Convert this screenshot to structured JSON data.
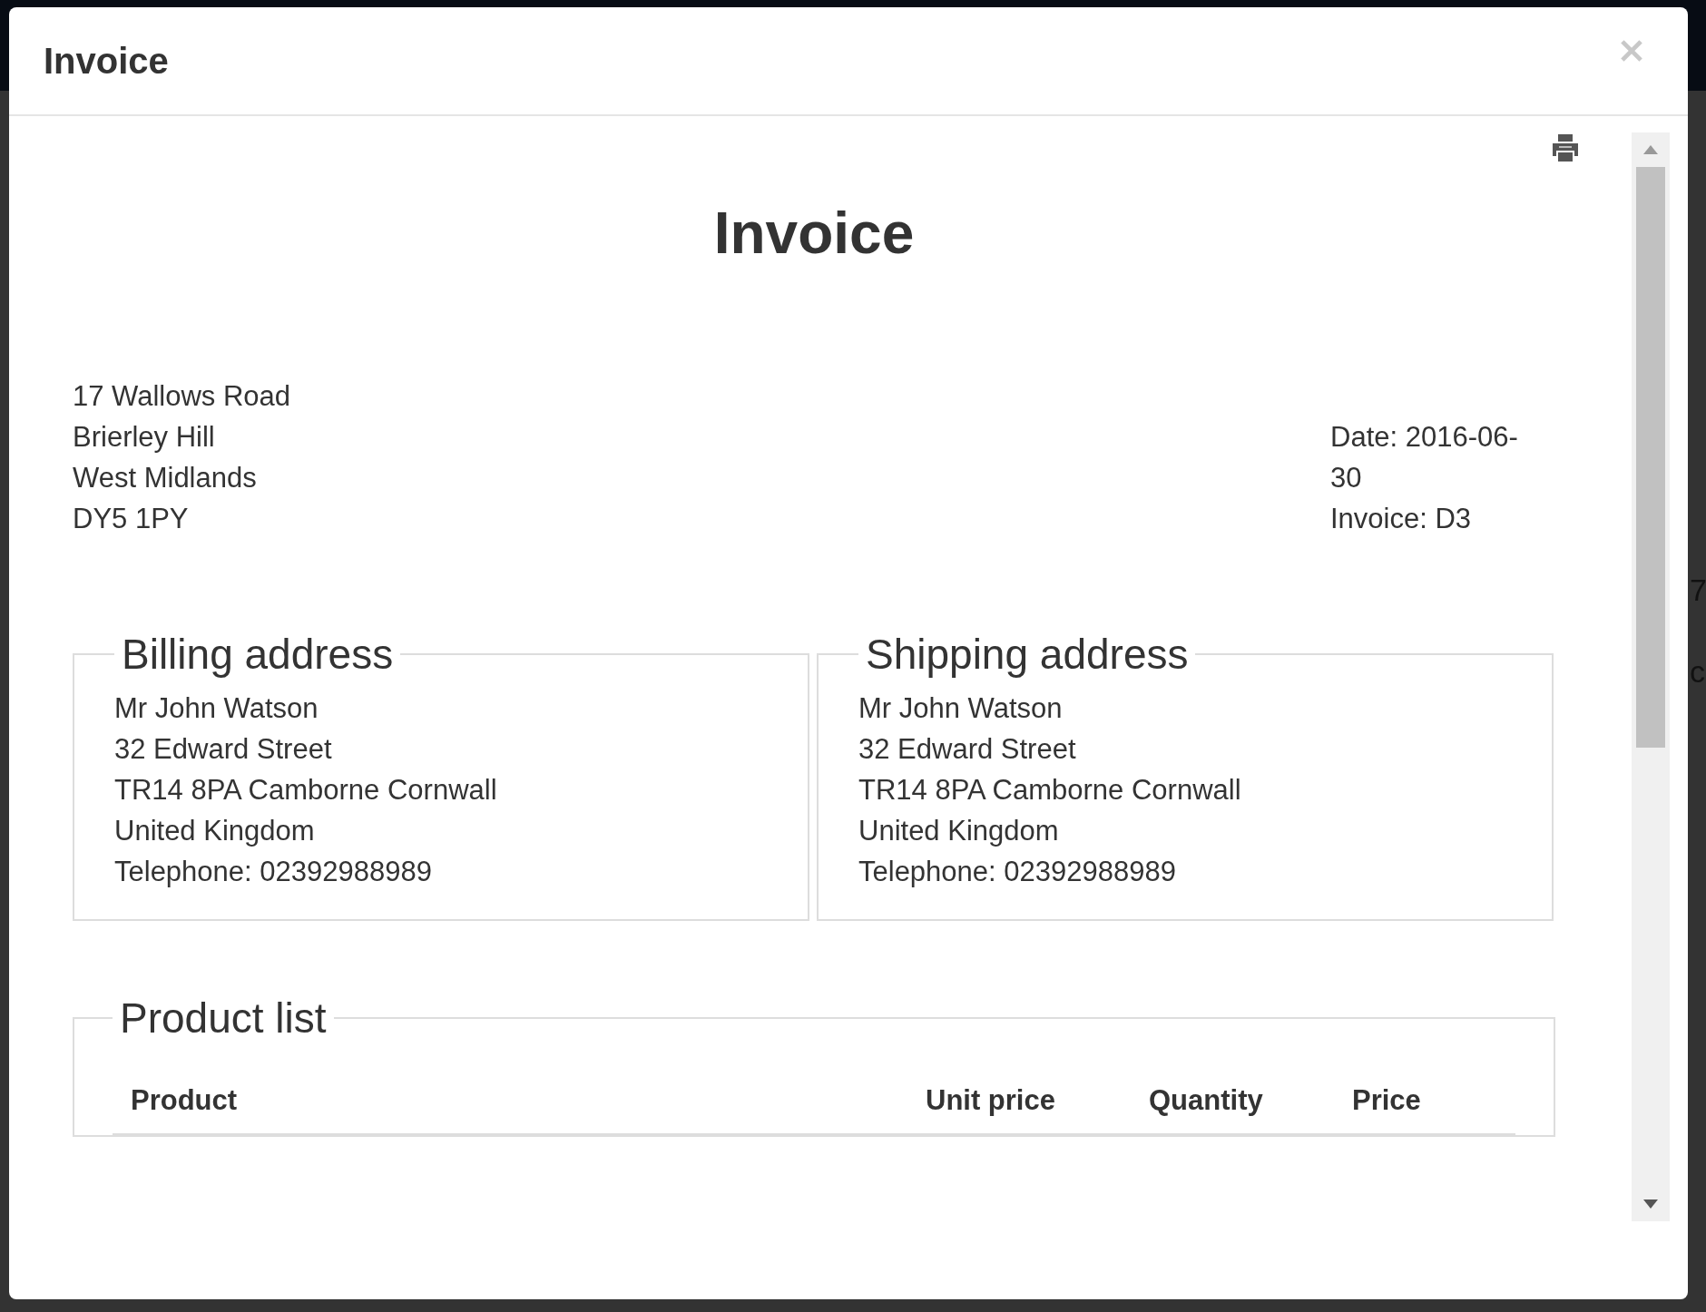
{
  "window": {
    "title": "Invoice"
  },
  "document": {
    "title": "Invoice",
    "sender_address": [
      "17 Wallows Road",
      "Brierley Hill",
      "West Midlands",
      "DY5 1PY"
    ],
    "meta": [
      "Date: 2016-06-30",
      "Invoice: D3"
    ],
    "addresses": [
      {
        "heading": "Billing address",
        "lines": [
          "Mr John Watson",
          "32 Edward Street",
          "TR14 8PA Camborne Cornwall",
          "United Kingdom",
          "Telephone: 02392988989"
        ]
      },
      {
        "heading": "Shipping address",
        "lines": [
          "Mr John Watson",
          "32 Edward Street",
          "TR14 8PA Camborne Cornwall",
          "United Kingdom",
          "Telephone: 02392988989"
        ]
      }
    ],
    "product_list": {
      "heading": "Product list",
      "columns": [
        "Product",
        "Unit price",
        "Quantity",
        "Price"
      ]
    }
  },
  "background_fragments": [
    "7",
    "c"
  ]
}
